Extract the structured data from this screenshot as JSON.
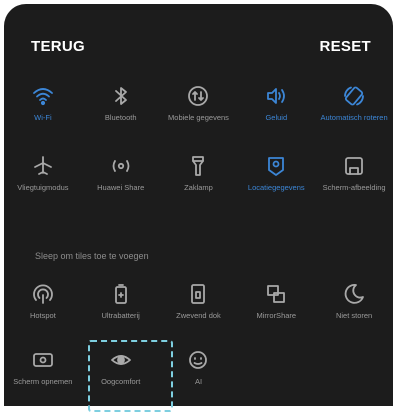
{
  "header": {
    "back_label": "TERUG",
    "reset_label": "RESET"
  },
  "active_tiles": {
    "row1": [
      {
        "label": "Wi-Fi",
        "icon": "wifi-icon",
        "on": true
      },
      {
        "label": "Bluetooth",
        "icon": "bluetooth-icon",
        "on": false
      },
      {
        "label": "Mobiele gegevens",
        "icon": "mobile-data-icon",
        "on": false
      },
      {
        "label": "Geluid",
        "icon": "sound-icon",
        "on": true
      },
      {
        "label": "Automatisch roteren",
        "icon": "auto-rotate-icon",
        "on": true
      }
    ],
    "row2": [
      {
        "label": "Vliegtuigmodus",
        "icon": "airplane-icon",
        "on": false
      },
      {
        "label": "Huawei Share",
        "icon": "huawei-share-icon",
        "on": false
      },
      {
        "label": "Zaklamp",
        "icon": "flashlight-icon",
        "on": false
      },
      {
        "label": "Locatiegegevens",
        "icon": "location-icon",
        "on": true
      },
      {
        "label": "Scherm-afbeelding",
        "icon": "screenshot-icon",
        "on": false
      }
    ]
  },
  "section_label": "Sleep om tiles toe te voegen",
  "available_tiles": {
    "row3": [
      {
        "label": "Hotspot",
        "icon": "hotspot-icon"
      },
      {
        "label": "Ultrabatterij",
        "icon": "battery-icon"
      },
      {
        "label": "Zwevend dok",
        "icon": "floating-dock-icon"
      },
      {
        "label": "MirrorShare",
        "icon": "mirrorshare-icon"
      },
      {
        "label": "Niet storen",
        "icon": "moon-icon"
      }
    ],
    "row4": [
      {
        "label": "Scherm opnemen",
        "icon": "screen-record-icon"
      },
      {
        "label": "Oogcomfort",
        "icon": "eye-comfort-icon"
      },
      {
        "label": "AI",
        "icon": "ai-icon"
      }
    ]
  },
  "colors": {
    "background": "#1c1c1c",
    "active": "#3c86d6",
    "inactive": "#a9a9a9",
    "highlight_border": "#7ecfe0"
  }
}
